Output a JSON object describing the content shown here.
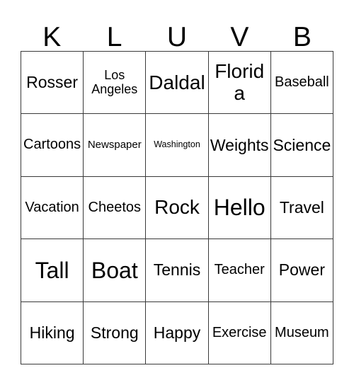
{
  "card": {
    "type": "bingo-card",
    "columns": 5,
    "rows": 5,
    "header": {
      "letters": [
        "K",
        "L",
        "U",
        "V",
        "B"
      ]
    },
    "colors": {
      "background": "#ffffff",
      "text": "#000000",
      "grid_line": "#3a3a3a"
    },
    "grid": [
      [
        {
          "text": "Rosser",
          "size": "fs-lg"
        },
        {
          "text": "Los Angeles",
          "size": "fs-wrap"
        },
        {
          "text": "Daldal",
          "size": "fs-xl"
        },
        {
          "text": "Florida",
          "size": "fs-xl"
        },
        {
          "text": "Baseball",
          "size": "fs-md"
        }
      ],
      [
        {
          "text": "Cartoons",
          "size": "fs-md"
        },
        {
          "text": "Newspaper",
          "size": "fs-xs"
        },
        {
          "text": "Washington",
          "size": "fs-xxs"
        },
        {
          "text": "Weights",
          "size": "fs-lg"
        },
        {
          "text": "Science",
          "size": "fs-lg"
        }
      ],
      [
        {
          "text": "Vacation",
          "size": "fs-md"
        },
        {
          "text": "Cheetos",
          "size": "fs-md"
        },
        {
          "text": "Rock",
          "size": "fs-xl"
        },
        {
          "text": "Hello",
          "size": "fs-xxl"
        },
        {
          "text": "Travel",
          "size": "fs-lg"
        }
      ],
      [
        {
          "text": "Tall",
          "size": "fs-xxl"
        },
        {
          "text": "Boat",
          "size": "fs-xxl"
        },
        {
          "text": "Tennis",
          "size": "fs-lg"
        },
        {
          "text": "Teacher",
          "size": "fs-md"
        },
        {
          "text": "Power",
          "size": "fs-lg"
        }
      ],
      [
        {
          "text": "Hiking",
          "size": "fs-lg"
        },
        {
          "text": "Strong",
          "size": "fs-lg"
        },
        {
          "text": "Happy",
          "size": "fs-lg"
        },
        {
          "text": "Exercise",
          "size": "fs-md"
        },
        {
          "text": "Museum",
          "size": "fs-md"
        }
      ]
    ]
  }
}
